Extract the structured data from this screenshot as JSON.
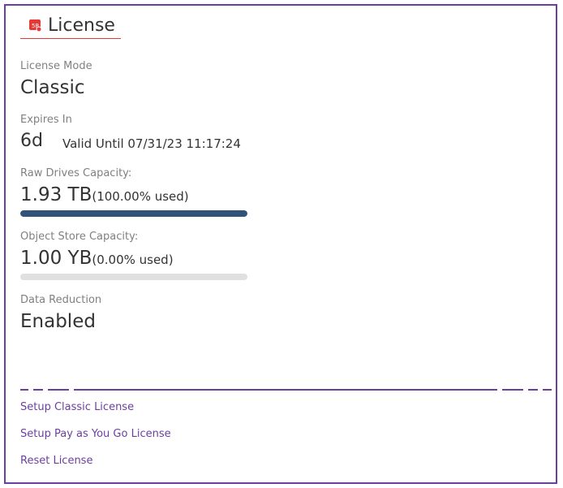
{
  "header": {
    "title": "License",
    "icon": "license-icon"
  },
  "license_mode": {
    "label": "License Mode",
    "value": "Classic"
  },
  "expires": {
    "label": "Expires In",
    "value": "6d",
    "valid_until": "Valid Until 07/31/23 11:17:24"
  },
  "raw_drives": {
    "label": "Raw Drives Capacity:",
    "value": "1.93 TB",
    "used": "(100.00% used)",
    "fraction_used": 1.0
  },
  "object_store": {
    "label": "Object Store Capacity:",
    "value": "1.00 YB",
    "used": "(0.00% used)",
    "fraction_used": 0.0
  },
  "data_reduction": {
    "label": "Data Reduction",
    "value": "Enabled"
  },
  "links": {
    "setup_classic": "Setup Classic License",
    "setup_payg": "Setup Pay as You Go License",
    "reset": "Reset License"
  },
  "colors": {
    "accent": "#6b3fa0",
    "bar_fill": "#2f5379",
    "bar_track": "#e0e0e0",
    "icon_red": "#e53935"
  }
}
